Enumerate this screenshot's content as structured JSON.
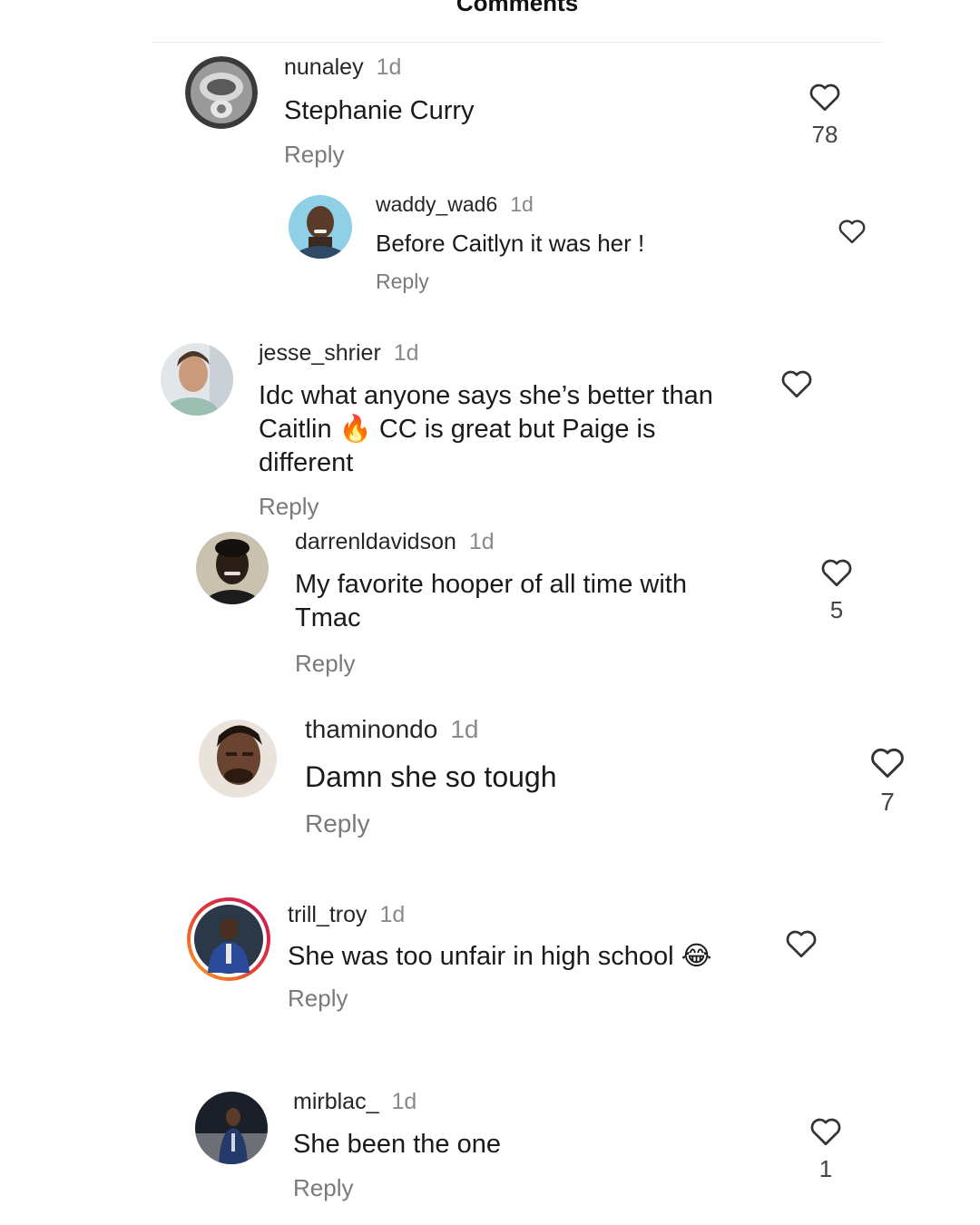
{
  "header": {
    "title": "Comments"
  },
  "comments": [
    {
      "username": "nunaley",
      "time": "1d",
      "text": "Stephanie Curry",
      "reply": "Reply",
      "likes": "78"
    },
    {
      "username": "waddy_wad6",
      "time": "1d",
      "text": "Before Caitlyn it was her !",
      "reply": "Reply",
      "likes": ""
    },
    {
      "username": "jesse_shrier",
      "time": "1d",
      "text_lines": [
        "Idc what anyone says she’s better than",
        "Caitlin",
        "CC is great but Paige is",
        "different"
      ],
      "emoji": "🔥",
      "reply": "Reply",
      "likes": ""
    },
    {
      "username": "darrenldavidson",
      "time": "1d",
      "text_lines": [
        "My favorite hooper of all time with",
        "Tmac"
      ],
      "reply": "Reply",
      "likes": "5"
    },
    {
      "username": "thaminondo",
      "time": "1d",
      "text": "Damn she so tough",
      "reply": "Reply",
      "likes": "7"
    },
    {
      "username": "trill_troy",
      "time": "1d",
      "text": "She was too unfair in high school",
      "emoji": "😂",
      "reply": "Reply",
      "likes": ""
    },
    {
      "username": "mirblac_",
      "time": "1d",
      "text": "She been the one",
      "reply": "Reply",
      "likes": "1"
    }
  ],
  "icons": {
    "like": "heart-outline-icon"
  },
  "colors": {
    "username": "#262626",
    "secondary": "#8a8a8a",
    "reply": "#7a7a7a",
    "story_ring_start": "#f9a825",
    "story_ring_end": "#c2185b"
  }
}
